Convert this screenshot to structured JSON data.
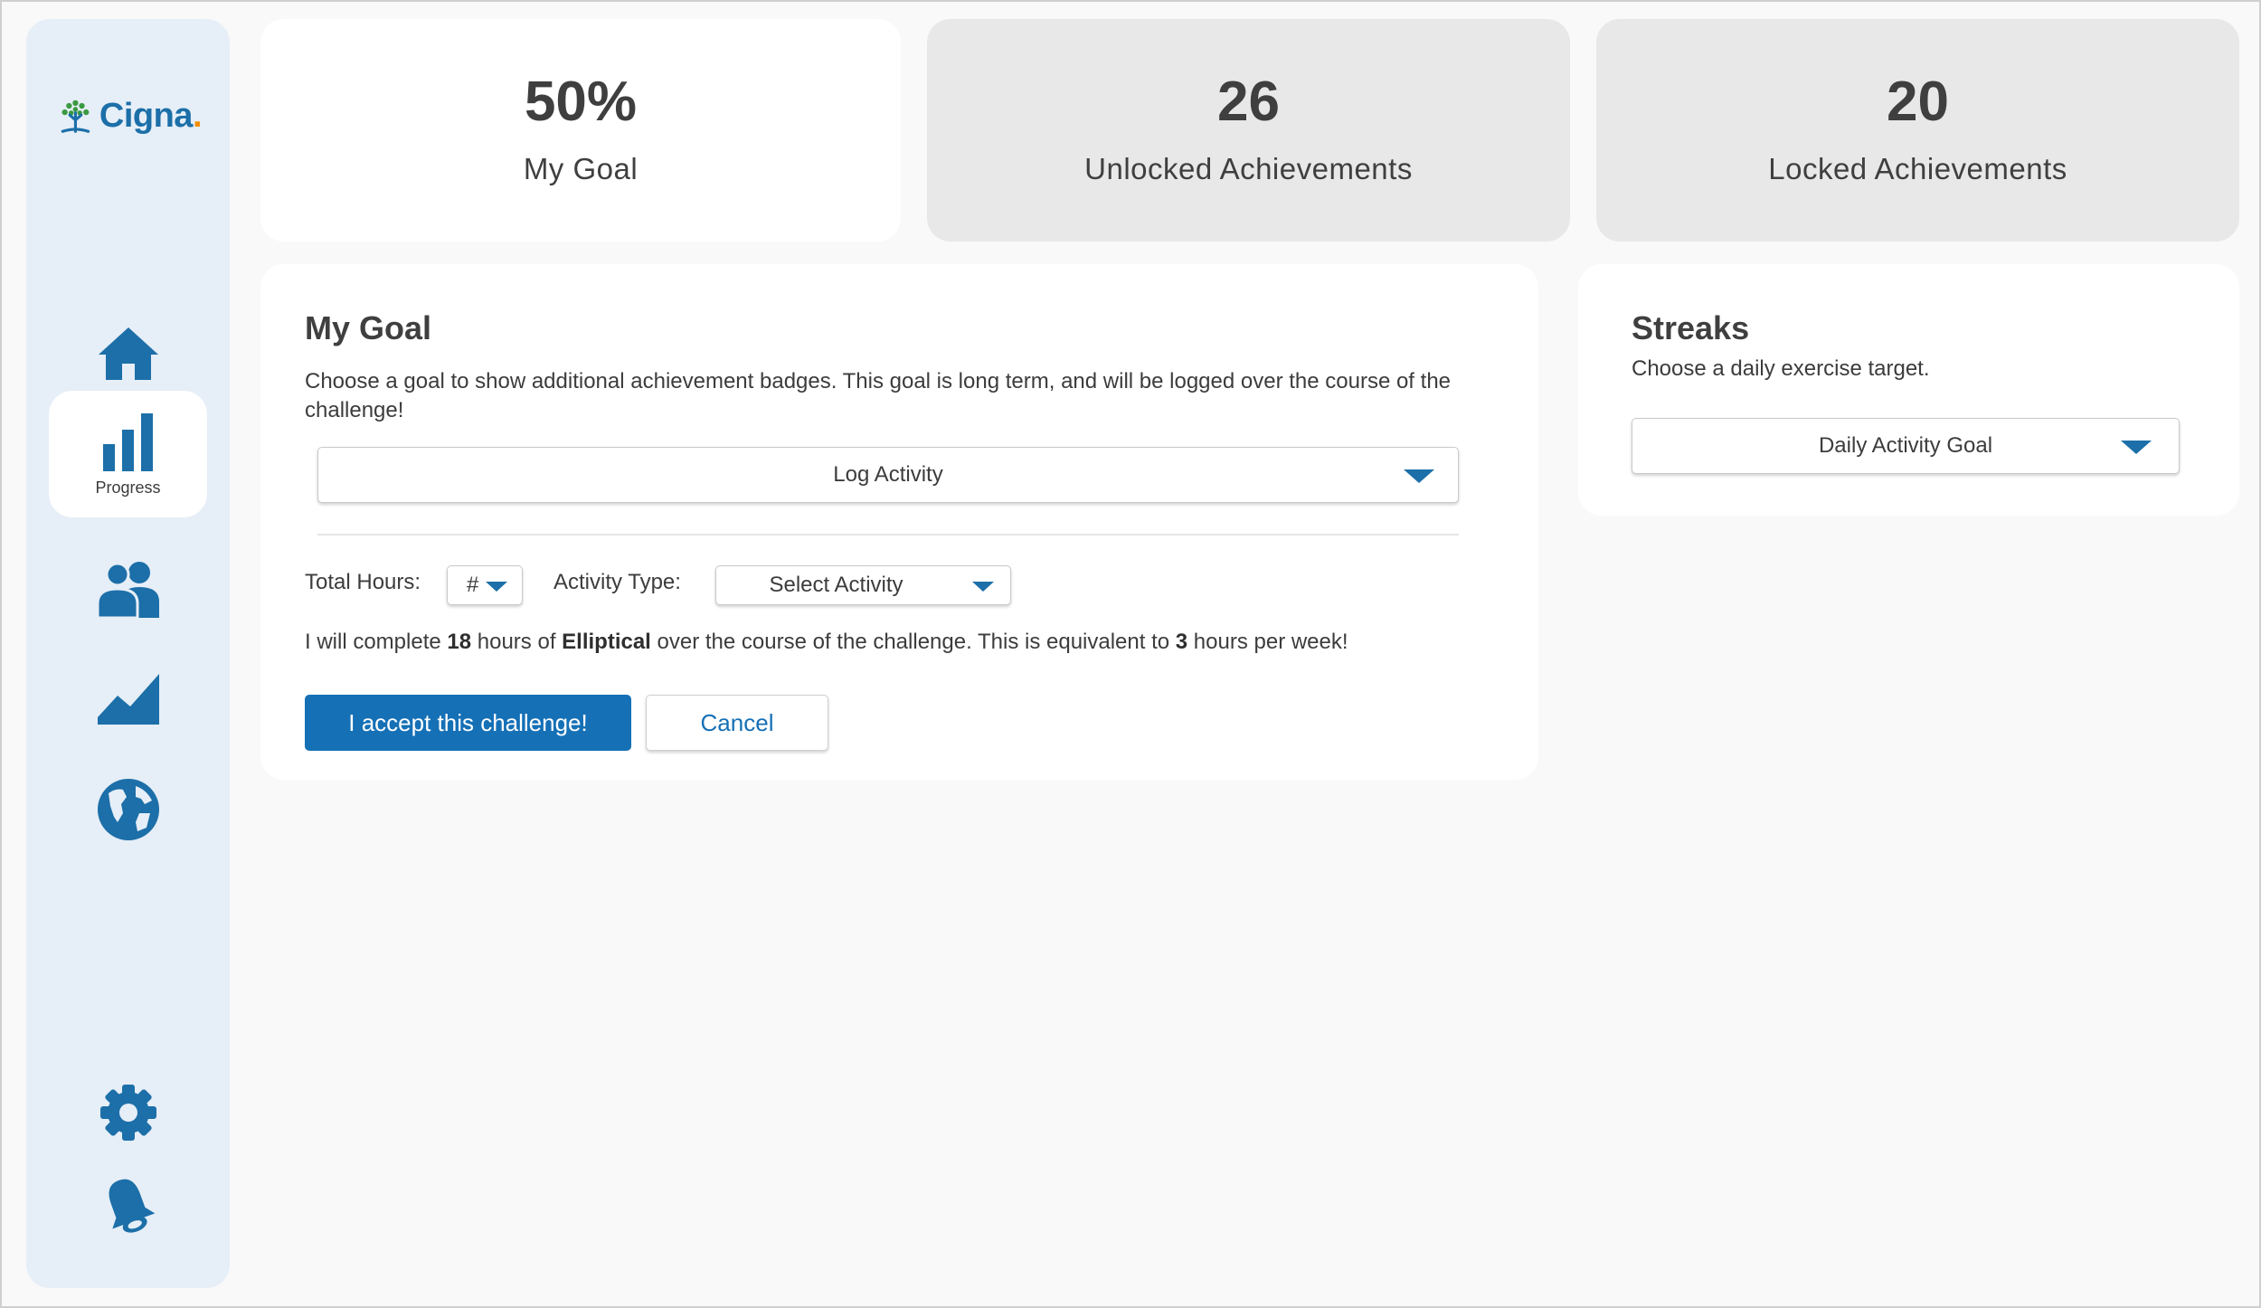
{
  "brand": {
    "name": "Cigna",
    "accent": "#1c6fa8"
  },
  "sidebar": {
    "items": [
      {
        "icon": "home-icon"
      },
      {
        "icon": "bar-chart-icon",
        "label": "Progress",
        "active": true
      },
      {
        "icon": "people-icon"
      },
      {
        "icon": "trend-chart-icon"
      },
      {
        "icon": "globe-icon"
      },
      {
        "icon": "gear-icon"
      },
      {
        "icon": "bell-icon"
      }
    ]
  },
  "stats": [
    {
      "value": "50%",
      "caption": "My Goal"
    },
    {
      "value": "26",
      "caption": "Unlocked Achievements"
    },
    {
      "value": "20",
      "caption": "Locked Achievements"
    }
  ],
  "goal": {
    "title": "My Goal",
    "description": "Choose a goal to show additional achievement badges. This goal is long term, and will be logged over the course of the challenge!",
    "dropdown_value": "Log Activity",
    "hours_label": "Total Hours:",
    "hours_value": "#",
    "activity_label": "Activity Type:",
    "activity_value": "Select Activity",
    "sentence": {
      "p1": "I will complete ",
      "hours": "18",
      "p2": " hours of ",
      "activity": "Elliptical",
      "p3": " over the course of the challenge. This is equivalent to ",
      "weekly": "3",
      "p4": " hours per week!"
    },
    "accept_label": "I accept this challenge!",
    "cancel_label": "Cancel"
  },
  "streaks": {
    "title": "Streaks",
    "description": "Choose a daily exercise target.",
    "dropdown_value": "Daily Activity Goal"
  }
}
